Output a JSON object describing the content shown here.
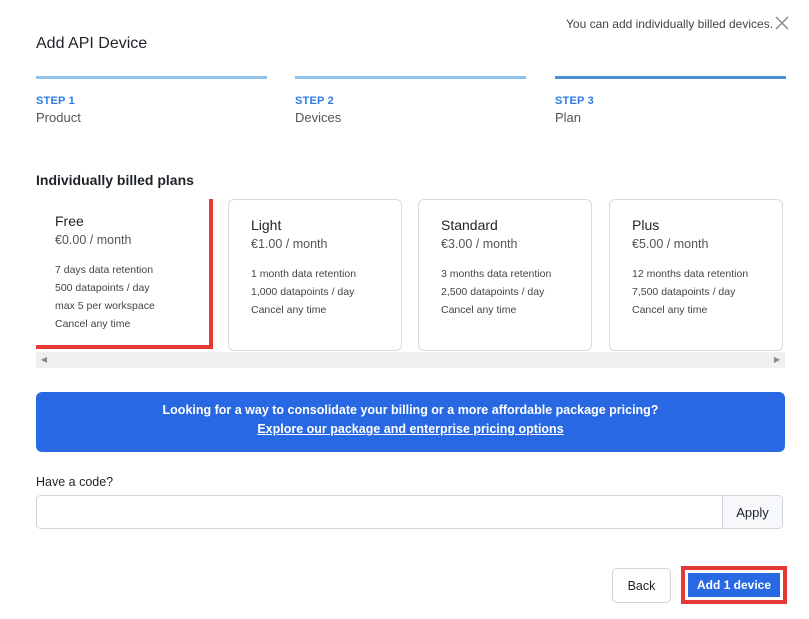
{
  "header": {
    "note": "You can add individually billed devices.",
    "title": "Add API Device"
  },
  "steps": [
    {
      "num": "STEP 1",
      "label": "Product"
    },
    {
      "num": "STEP 2",
      "label": "Devices"
    },
    {
      "num": "STEP 3",
      "label": "Plan"
    }
  ],
  "plans_section": {
    "title": "Individually billed plans",
    "plans": [
      {
        "name": "Free",
        "price": "€0.00 / month",
        "features": [
          "7 days data retention",
          "500 datapoints / day",
          "max 5 per workspace",
          "Cancel any time"
        ]
      },
      {
        "name": "Light",
        "price": "€1.00 / month",
        "features": [
          "1 month data retention",
          "1,000 datapoints / day",
          "Cancel any time"
        ]
      },
      {
        "name": "Standard",
        "price": "€3.00 / month",
        "features": [
          "3 months data retention",
          "2,500 datapoints / day",
          "Cancel any time"
        ]
      },
      {
        "name": "Plus",
        "price": "€5.00 / month",
        "features": [
          "12 months data retention",
          "7,500 datapoints / day",
          "Cancel any time"
        ]
      }
    ]
  },
  "promo": {
    "text": "Looking for a way to consolidate your billing or a more affordable package pricing?",
    "link": "Explore our package and enterprise pricing options"
  },
  "code": {
    "label": "Have a code?",
    "value": "",
    "apply_label": "Apply"
  },
  "footer": {
    "back_label": "Back",
    "add_label": "Add 1 device"
  },
  "colors": {
    "accent": "#2868e3",
    "highlight": "#e53935",
    "step_bar": "#8ec3ef"
  }
}
